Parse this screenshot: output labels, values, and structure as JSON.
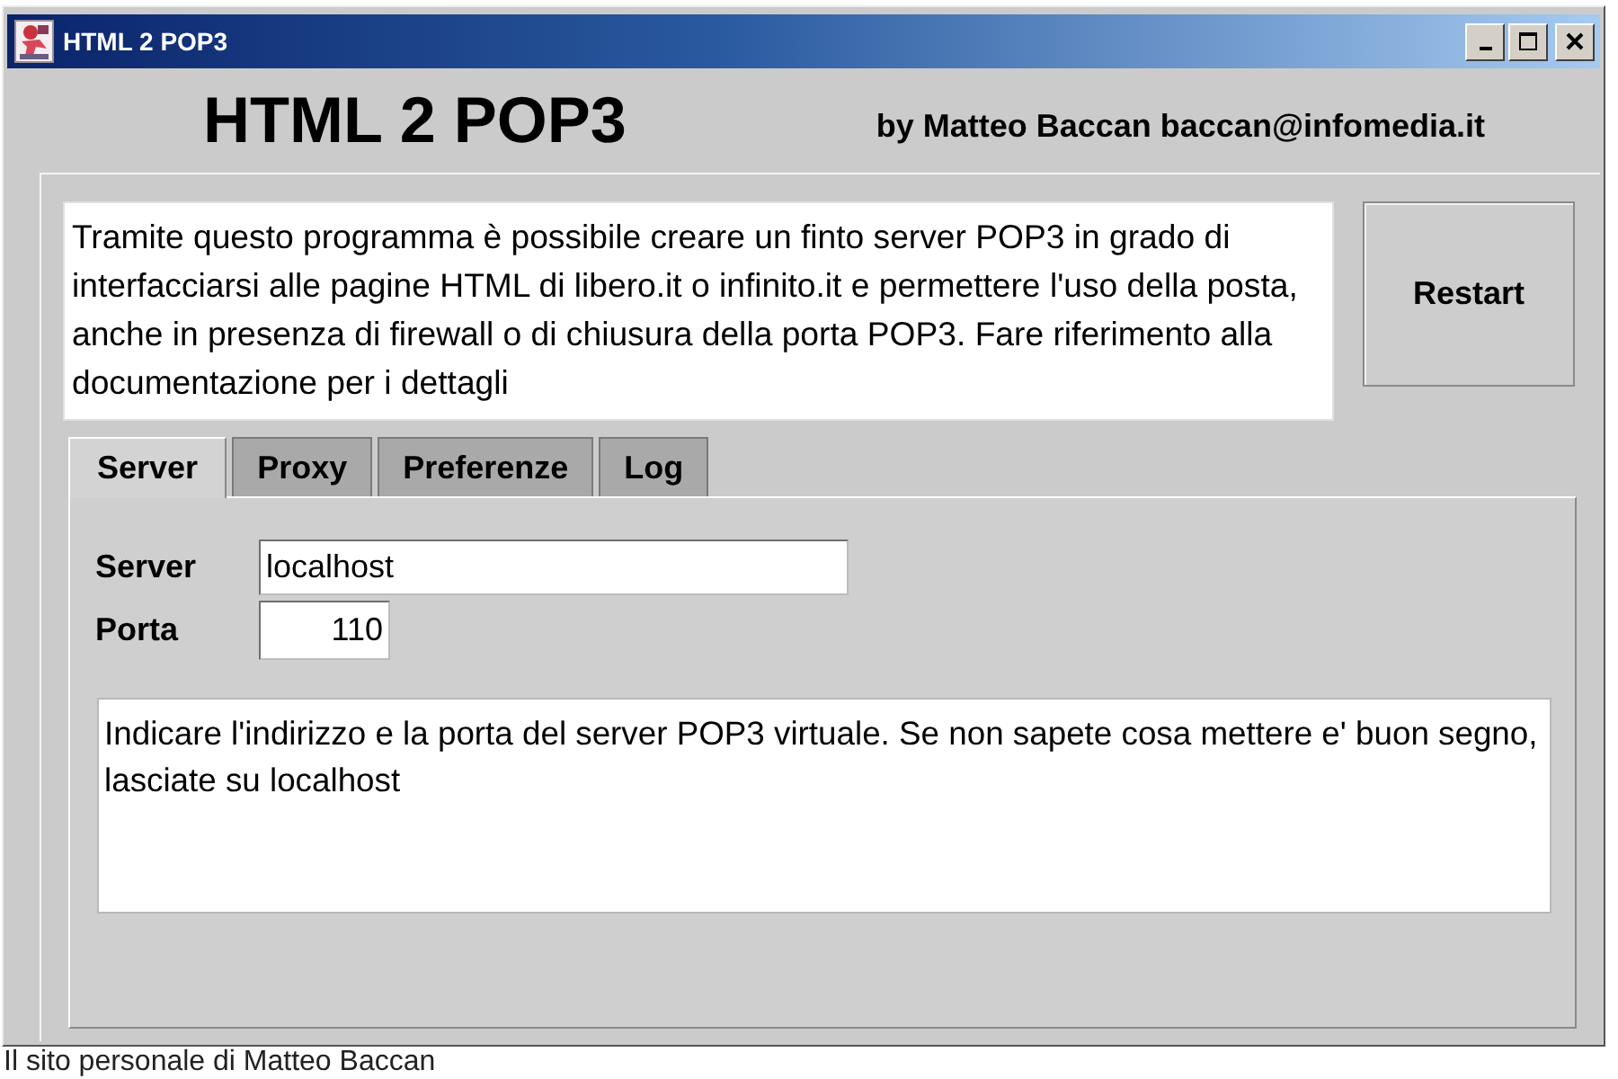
{
  "window": {
    "title": "HTML 2 POP3",
    "buttons": [
      {
        "kind": "minimize"
      },
      {
        "kind": "maximize"
      },
      {
        "kind": "close"
      }
    ]
  },
  "header": {
    "title": "HTML 2 POP3",
    "byline": "by Matteo Baccan baccan@infomedia.it"
  },
  "description": "Tramite questo programma è possibile creare un finto server POP3 in grado di interfacciarsi alle pagine HTML di libero.it o infinito.it e permettere l'uso della posta, anche in presenza di firewall o di chiusura della porta POP3. Fare riferimento alla documentazione per i dettagli",
  "restart_button": {
    "label": "Restart"
  },
  "tabs": [
    {
      "label": "Server",
      "selected": true
    },
    {
      "label": "Proxy",
      "selected": false
    },
    {
      "label": "Preferenze",
      "selected": false
    },
    {
      "label": "Log",
      "selected": false
    }
  ],
  "server_panel": {
    "fields": [
      {
        "label": "Server",
        "value": "localhost",
        "kind": "text"
      },
      {
        "label": "Porta",
        "value": "110",
        "kind": "number"
      }
    ],
    "info": "Indicare l'indirizzo e la porta del server POP3 virtuale. Se non sapete cosa mettere e' buon segno, lasciate su localhost"
  },
  "caption": "Il sito personale di Matteo Baccan"
}
